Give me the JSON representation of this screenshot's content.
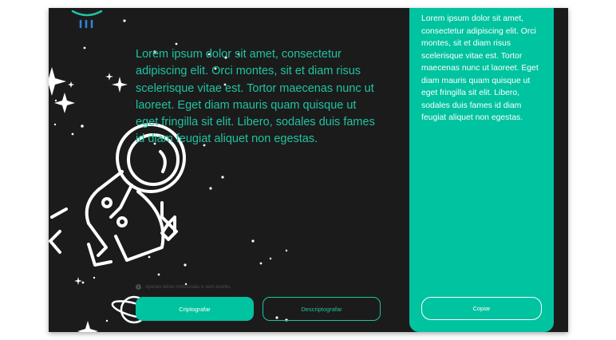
{
  "main": {
    "text": "Lorem ipsum dolor sit amet, consectetur adipiscing elit. Orci montes, sit et diam risus scelerisque vitae est. Tortor maecenas nunc ut laoreet. Eget diam mauris quam quisque ut eget fringilla sit elit. Libero, sodales duis fames id diam feugiat aliquet non egestas.",
    "hint": "Apenas letras minúsculas e sem acento."
  },
  "buttons": {
    "encrypt_label": "Criptografar",
    "decrypt_label": "Descriptografar"
  },
  "output_panel": {
    "text": "Lorem ipsum dolor sit amet, consectetur adipiscing elit. Orci montes, sit et diam risus scelerisque vitae est. Tortor maecenas nunc ut laoreet. Eget diam mauris quam quisque ut eget fringilla sit elit. Libero, sodales duis fames id diam feugiat aliquet non egestas.",
    "copy_label": "Copiar"
  },
  "icons": {
    "logo": "ufo-icon",
    "info": "info-icon",
    "illustration": "astronaut-illustration",
    "planet": "planet-icon"
  },
  "colors": {
    "background": "#1b1b1b",
    "accent": "#00c3a0",
    "accent_text": "#1fc3a1",
    "panel_text": "#ffffff"
  }
}
